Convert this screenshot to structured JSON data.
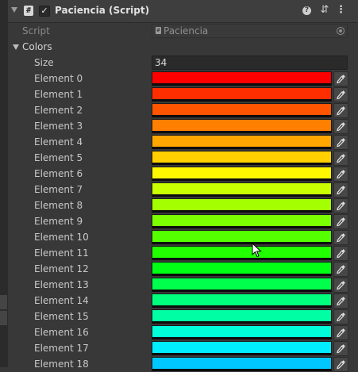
{
  "component": {
    "title": "Paciencia (Script)",
    "script_icon_glyph": "#",
    "enabled_glyph": "✓",
    "help_glyph": "?",
    "presets_glyph": "⇵",
    "menu_glyph": "⋮"
  },
  "script_field": {
    "label": "Script",
    "value": "Paciencia"
  },
  "colors": {
    "label": "Colors",
    "size_label": "Size",
    "size_value": "34",
    "elements": [
      {
        "label": "Element 0",
        "color": "#ff0000"
      },
      {
        "label": "Element 1",
        "color": "#ff2e00"
      },
      {
        "label": "Element 2",
        "color": "#ff5400"
      },
      {
        "label": "Element 3",
        "color": "#ff7f00"
      },
      {
        "label": "Element 4",
        "color": "#ffa700"
      },
      {
        "label": "Element 5",
        "color": "#ffcf00"
      },
      {
        "label": "Element 6",
        "color": "#fff700"
      },
      {
        "label": "Element 7",
        "color": "#c9ff00"
      },
      {
        "label": "Element 8",
        "color": "#a4ff00"
      },
      {
        "label": "Element 9",
        "color": "#7cff00"
      },
      {
        "label": "Element 10",
        "color": "#54ff00"
      },
      {
        "label": "Element 11",
        "color": "#22ff00"
      },
      {
        "label": "Element 12",
        "color": "#00ff14"
      },
      {
        "label": "Element 13",
        "color": "#00ff4c"
      },
      {
        "label": "Element 14",
        "color": "#00ff7c"
      },
      {
        "label": "Element 15",
        "color": "#00ffa4"
      },
      {
        "label": "Element 16",
        "color": "#00ffd8"
      },
      {
        "label": "Element 17",
        "color": "#00ecff"
      },
      {
        "label": "Element 18",
        "color": "#00c8ff"
      }
    ]
  },
  "icons": {
    "eyedropper": "eyedropper-icon",
    "cursor": "mouse-cursor-icon"
  }
}
